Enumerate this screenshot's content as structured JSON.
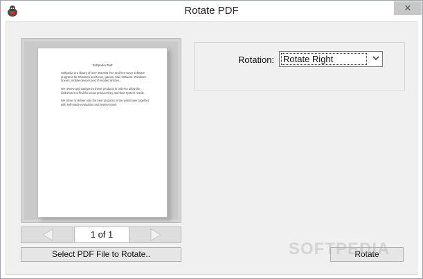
{
  "window": {
    "title": "Rotate PDF",
    "close_glyph": "✕",
    "icon": "pdf-tool-icon"
  },
  "preview": {
    "document": {
      "title": "Softpedia Test",
      "paragraphs": [
        "Softpedia is a library of over 300,000 free and free-to-try software programs for Windows and Linux, games, Mac software, Windows drivers, mobile devices and IT-related articles.",
        "We review and categorize these products in order to allow the visitor/user to find the exact product they and their system needs.",
        "We strive to deliver only the best products to the visitor/user together with self-made evaluation and review notes."
      ]
    },
    "page_indicator": "1 of 1",
    "prev_icon": "triangle-left-icon",
    "next_icon": "triangle-right-icon"
  },
  "buttons": {
    "select_file": "Select PDF File to Rotate..",
    "rotate": "Rotate"
  },
  "rotation": {
    "label": "Rotation:",
    "selected": "Rotate Right"
  },
  "watermark": "SOFTPEDIA"
}
